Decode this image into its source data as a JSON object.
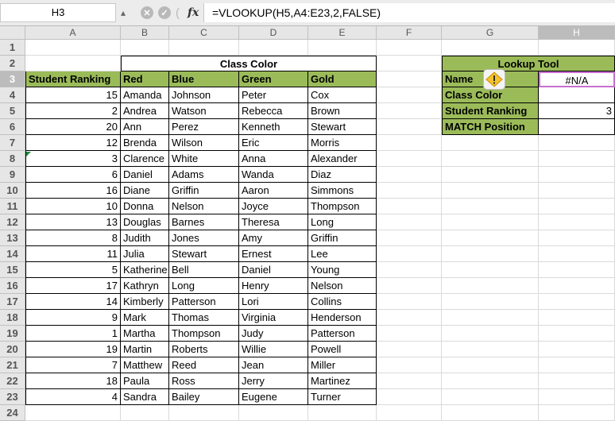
{
  "formula_bar": {
    "name_box": "H3",
    "formula": "=VLOOKUP(H5,A4:E23,2,FALSE)",
    "cancel_icon": "cancel-icon",
    "confirm_icon": "confirm-icon",
    "fx_label": "fx"
  },
  "columns": [
    "A",
    "B",
    "C",
    "D",
    "E",
    "F",
    "G",
    "H"
  ],
  "rows": [
    "1",
    "2",
    "3",
    "4",
    "5",
    "6",
    "7",
    "8",
    "9",
    "10",
    "11",
    "12",
    "13",
    "14",
    "15",
    "16",
    "17",
    "18",
    "19",
    "20",
    "21",
    "22",
    "23",
    "24"
  ],
  "table": {
    "group_header": "Class Color",
    "headers": [
      "Student Ranking",
      "Red",
      "Blue",
      "Green",
      "Gold"
    ],
    "data": [
      [
        "15",
        "Amanda",
        "Johnson",
        "Peter",
        "Cox"
      ],
      [
        "2",
        "Andrea",
        "Watson",
        "Rebecca",
        "Brown"
      ],
      [
        "20",
        "Ann",
        "Perez",
        "Kenneth",
        "Stewart"
      ],
      [
        "12",
        "Brenda",
        "Wilson",
        "Eric",
        "Morris"
      ],
      [
        "3",
        "Clarence",
        "White",
        "Anna",
        "Alexander"
      ],
      [
        "6",
        "Daniel",
        "Adams",
        "Wanda",
        "Diaz"
      ],
      [
        "16",
        "Diane",
        "Griffin",
        "Aaron",
        "Simmons"
      ],
      [
        "10",
        "Donna",
        "Nelson",
        "Joyce",
        "Thompson"
      ],
      [
        "13",
        "Douglas",
        "Barnes",
        "Theresa",
        "Long"
      ],
      [
        "8",
        "Judith",
        "Jones",
        "Amy",
        "Griffin"
      ],
      [
        "11",
        "Julia",
        "Stewart",
        "Ernest",
        "Lee"
      ],
      [
        "5",
        "Katherine",
        "Bell",
        "Daniel",
        "Young"
      ],
      [
        "17",
        "Kathryn",
        "Long",
        "Henry",
        "Nelson"
      ],
      [
        "14",
        "Kimberly",
        "Patterson",
        "Lori",
        "Collins"
      ],
      [
        "9",
        "Mark",
        "Thomas",
        "Virginia",
        "Henderson"
      ],
      [
        "1",
        "Martha",
        "Thompson",
        "Judy",
        "Patterson"
      ],
      [
        "19",
        "Martin",
        "Roberts",
        "Willie",
        "Powell"
      ],
      [
        "7",
        "Matthew",
        "Reed",
        "Jean",
        "Miller"
      ],
      [
        "18",
        "Paula",
        "Ross",
        "Jerry",
        "Martinez"
      ],
      [
        "4",
        "Sandra",
        "Bailey",
        "Eugene",
        "Turner"
      ]
    ]
  },
  "lookup": {
    "title": "Lookup Tool",
    "labels": [
      "Name",
      "Class Color",
      "Student Ranking",
      "MATCH Position"
    ],
    "values": [
      "#N/A",
      "",
      "3",
      ""
    ],
    "warning_icon": "warning-icon"
  }
}
